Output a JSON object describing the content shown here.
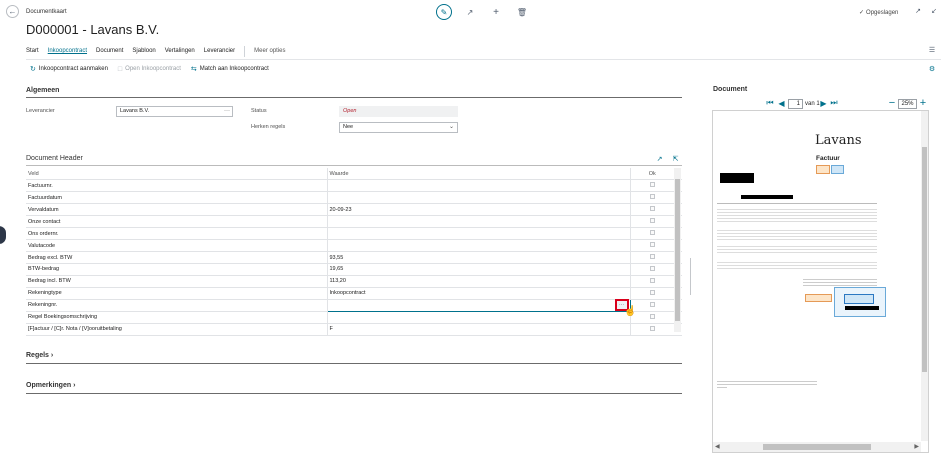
{
  "header": {
    "breadcrumb": "Documentkaart",
    "title": "D000001 - Lavans B.V.",
    "saved_status": "Opgeslagen"
  },
  "nav_tabs": [
    {
      "label": "Start"
    },
    {
      "label": "Inkoopcontract"
    },
    {
      "label": "Document"
    },
    {
      "label": "Sjabloon"
    },
    {
      "label": "Vertalingen"
    },
    {
      "label": "Leverancier"
    }
  ],
  "nav_more": "Meer opties",
  "actions": [
    {
      "label": "Inkoopcontract aanmaken",
      "enabled": true
    },
    {
      "label": "Open Inkoopcontract",
      "enabled": false
    },
    {
      "label": "Match aan Inkoopcontract",
      "enabled": true
    }
  ],
  "general": {
    "title": "Algemeen",
    "supplier_label": "Leverancier",
    "supplier_value": "Lavans B.V.",
    "status_label": "Status",
    "status_value": "Open",
    "recognize_label": "Herken regels",
    "recognize_value": "Nee"
  },
  "doc_header": {
    "title": "Document Header",
    "columns": [
      "Veld",
      "Waarde",
      "Ok"
    ],
    "rows": [
      {
        "field": "Factuurnr.",
        "value": ""
      },
      {
        "field": "Factuurdatum",
        "value": ""
      },
      {
        "field": "Vervaldatum",
        "value": "20-09-23"
      },
      {
        "field": "Onze contact",
        "value": ""
      },
      {
        "field": "Ons ordernr.",
        "value": ""
      },
      {
        "field": "Valutacode",
        "value": ""
      },
      {
        "field": "Bedrag excl. BTW",
        "value": "93,55"
      },
      {
        "field": "BTW-bedrag",
        "value": "19,65"
      },
      {
        "field": "Bedrag incl. BTW",
        "value": "113,20"
      },
      {
        "field": "Rekeningtype",
        "value": "Inkoopcontract"
      },
      {
        "field": "Rekeningnr.",
        "value": ""
      },
      {
        "field": "Regel Boekingsomschrijving",
        "value": ""
      },
      {
        "field": "[F]actuur / [C]r. Nota / [V]ooruitbetaling",
        "value": "F"
      }
    ]
  },
  "lines_section": "Regels",
  "remarks_section": "Opmerkingen",
  "document_panel": {
    "title": "Document",
    "page_current": "1",
    "page_of": "van 1",
    "zoom": "25%",
    "doc_brand": "Lavans",
    "doc_heading": "Factuur"
  },
  "colors": {
    "accent": "#00718c",
    "status_red": "#b21f2d",
    "highlight_red": "#d9001b"
  },
  "icons": {
    "back": "back-arrow-icon",
    "edit": "pencil-icon",
    "share": "share-icon",
    "add": "plus-icon",
    "delete": "trash-icon",
    "saved": "checkmark-icon"
  }
}
